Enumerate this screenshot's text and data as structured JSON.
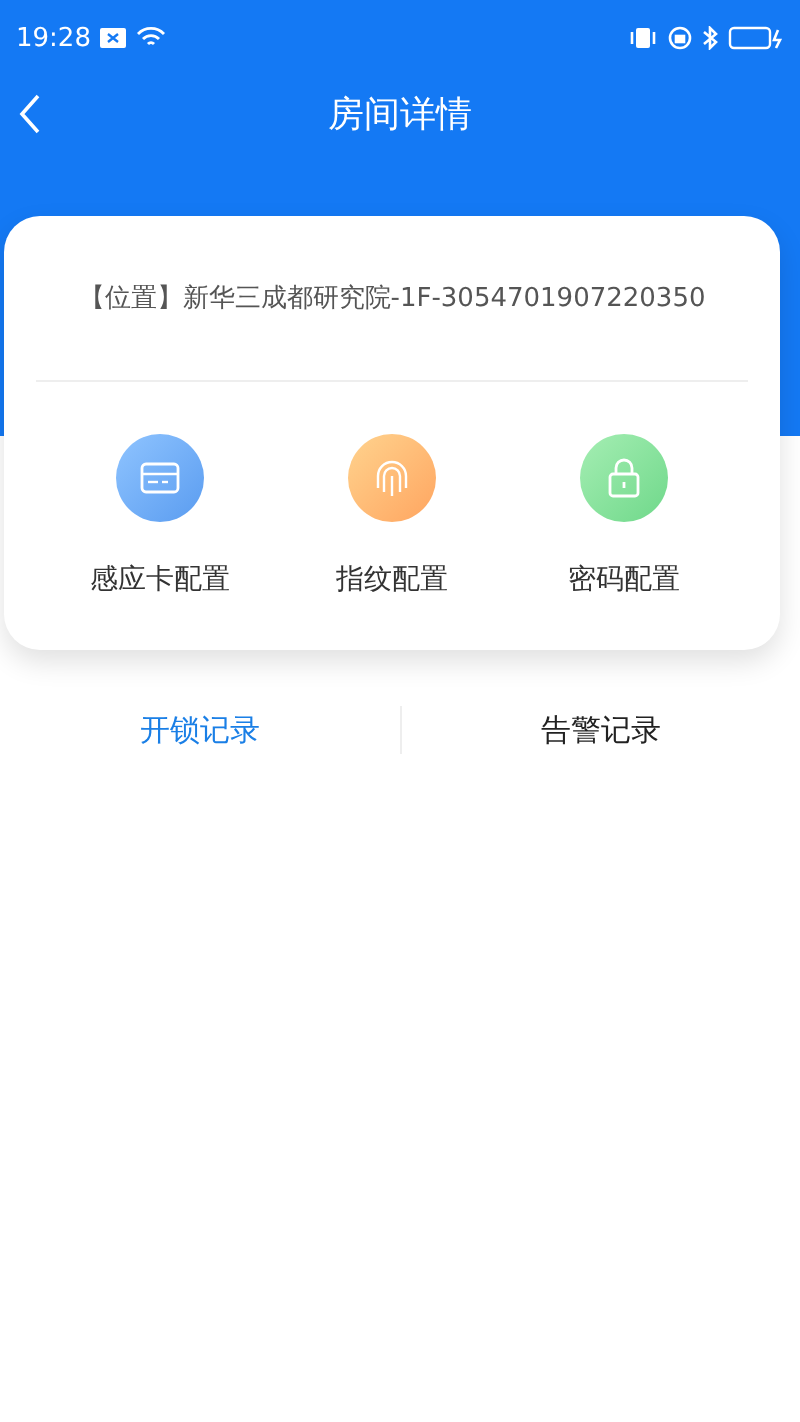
{
  "status_bar": {
    "time": "19:28"
  },
  "nav": {
    "title": "房间详情"
  },
  "room": {
    "location": "【位置】新华三成都研究院-1F-3054701907220350"
  },
  "config_items": [
    {
      "kind": "card",
      "label": "感应卡配置"
    },
    {
      "kind": "fingerprint",
      "label": "指纹配置"
    },
    {
      "kind": "password",
      "label": "密码配置"
    }
  ],
  "tabs": [
    {
      "label": "开锁记录",
      "selected": true
    },
    {
      "label": "告警记录",
      "selected": false
    }
  ]
}
